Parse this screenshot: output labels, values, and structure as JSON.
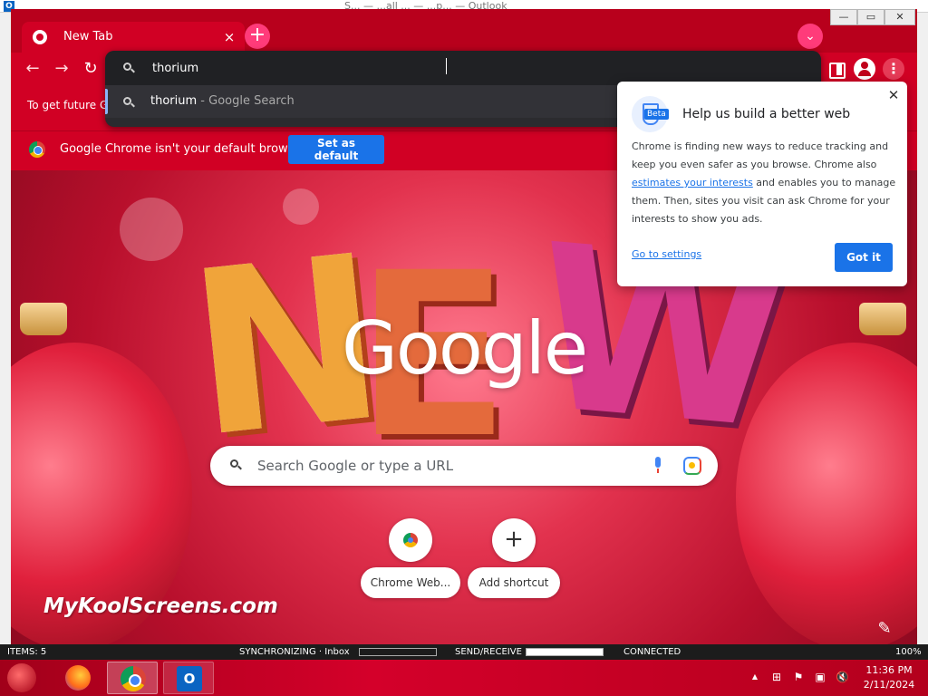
{
  "background_app": {
    "title_fragment": "S... — ...all ... — ...p... — Outlook",
    "status_bar": {
      "items_label": "ITEMS: 5",
      "sync_label": "SYNCHRONIZING · Inbox",
      "send_receive_label": "SEND/RECEIVE",
      "connection_label": "CONNECTED",
      "zoom_label": "100%"
    }
  },
  "window_controls": {
    "minimize": "—",
    "maximize": "▭",
    "close": "✕"
  },
  "tabs": [
    {
      "title": "New Tab",
      "close_glyph": "×"
    }
  ],
  "new_tab_glyph": "+",
  "tab_search_glyph": "⌄",
  "toolbar": {
    "back_glyph": "←",
    "forward_glyph": "→",
    "reload_glyph": "↻",
    "menu_glyph": "⋮"
  },
  "omnibox": {
    "value": "thorium",
    "suggestion_query": "thorium",
    "suggestion_separator": " - ",
    "suggestion_source": "Google Search"
  },
  "signin_bar": {
    "text": "To get future G"
  },
  "default_browser_bar": {
    "message": "Google Chrome isn't your default browser",
    "button_label": "Set as default"
  },
  "ntp": {
    "logo_text": "Google",
    "search_placeholder": "Search Google or type a URL",
    "shortcuts": [
      {
        "label": "Chrome Web...",
        "icon": "chrome-web-store-icon"
      },
      {
        "label": "Add shortcut",
        "icon": "plus-icon",
        "glyph": "+"
      }
    ],
    "watermark": "MyKoolScreens.com",
    "customize_glyph": "✎"
  },
  "privacy_popup": {
    "title": "Help us build a better web",
    "badge": "Beta",
    "body_part1": "Chrome is finding new ways to reduce tracking and keep you even safer as you browse. Chrome also ",
    "body_link": "estimates your interests",
    "body_part2": " and enables you to manage them. Then, sites you visit can ask Chrome for your interests to show you ads.",
    "settings_link": "Go to settings",
    "got_it_label": "Got it",
    "close_glyph": "✕"
  },
  "taskbar": {
    "apps": [
      {
        "name": "Firefox",
        "icon": "firefox-icon"
      },
      {
        "name": "Chrome",
        "icon": "chrome-icon"
      },
      {
        "name": "Outlook",
        "icon": "outlook-icon",
        "glyph": "O"
      }
    ],
    "clock_time": "11:36 PM",
    "clock_date": "2/11/2024",
    "tray_glyphs": {
      "arrow": "▲",
      "network": "⊞",
      "flag": "⚑",
      "monitor": "▣",
      "volume": "🔇"
    }
  },
  "colors": {
    "chrome_frame": "#c0001a",
    "omnibox_bg": "#202124",
    "accent_blue": "#1a73e8"
  }
}
